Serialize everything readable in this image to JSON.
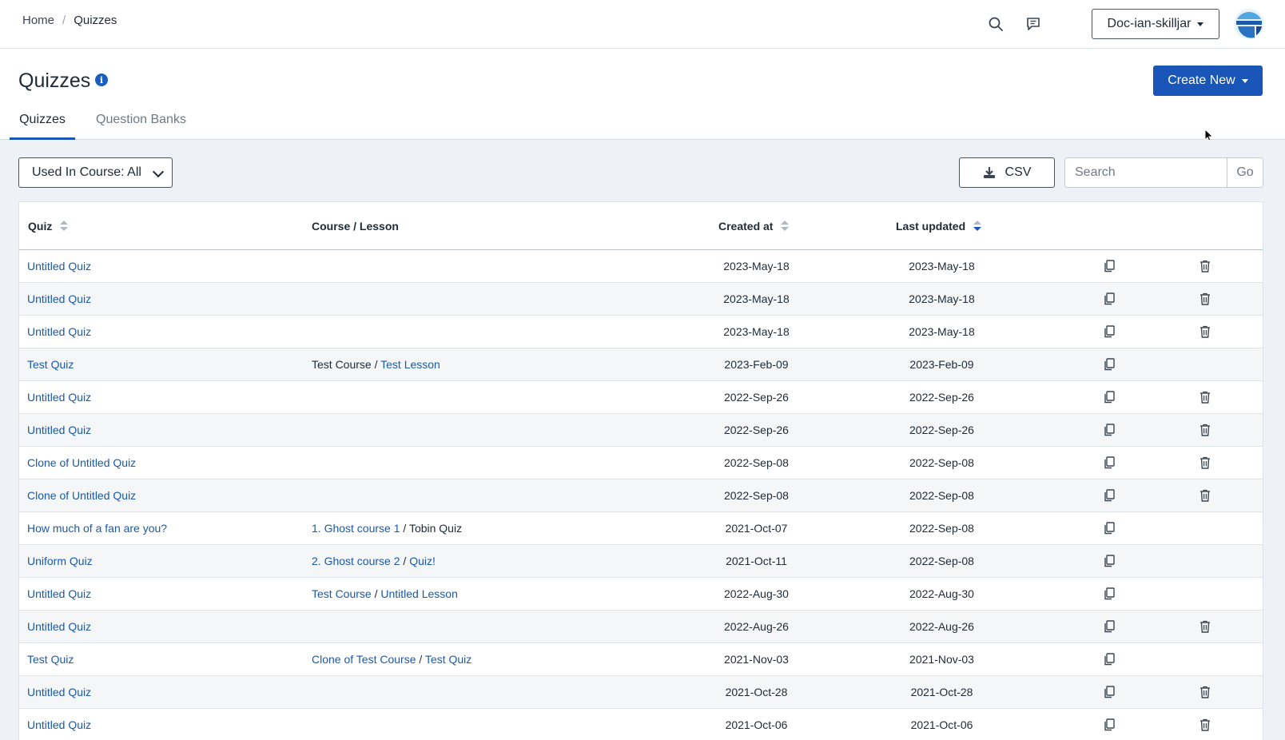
{
  "breadcrumb": {
    "home": "Home",
    "separator": "/",
    "current": "Quizzes"
  },
  "topbar": {
    "org_select": "Doc-ian-skilljar",
    "icons": [
      "search-icon",
      "chat-icon",
      "chevron-down-icon",
      "avatar"
    ]
  },
  "header": {
    "title": "Quizzes",
    "info_glyph": "i",
    "create_label": "Create New",
    "tabs": [
      {
        "label": "Quizzes",
        "active": true
      },
      {
        "label": "Question Banks",
        "active": false
      }
    ]
  },
  "toolbar": {
    "filter_label": "Used In Course: All",
    "csv_label": "CSV",
    "search_placeholder": "Search",
    "go_label": "Go"
  },
  "table": {
    "columns": {
      "quiz": "Quiz",
      "course": "Course / Lesson",
      "created": "Created at",
      "updated": "Last updated"
    },
    "sort": {
      "active_column": "Last updated",
      "direction": "desc"
    },
    "rows": [
      {
        "quiz": "Untitled Quiz",
        "course": "",
        "lesson": "",
        "created": "2023-May-18",
        "updated": "2023-May-18",
        "deletable": true
      },
      {
        "quiz": "Untitled Quiz",
        "course": "",
        "lesson": "",
        "created": "2023-May-18",
        "updated": "2023-May-18",
        "deletable": true
      },
      {
        "quiz": "Untitled Quiz",
        "course": "",
        "lesson": "",
        "created": "2023-May-18",
        "updated": "2023-May-18",
        "deletable": true
      },
      {
        "quiz": "Test Quiz",
        "course": "Test Course",
        "lesson": "Test Lesson",
        "course_linked": false,
        "lesson_linked": true,
        "created": "2023-Feb-09",
        "updated": "2023-Feb-09",
        "deletable": false
      },
      {
        "quiz": "Untitled Quiz",
        "course": "",
        "lesson": "",
        "created": "2022-Sep-26",
        "updated": "2022-Sep-26",
        "deletable": true
      },
      {
        "quiz": "Untitled Quiz",
        "course": "",
        "lesson": "",
        "created": "2022-Sep-26",
        "updated": "2022-Sep-26",
        "deletable": true
      },
      {
        "quiz": "Clone of Untitled Quiz",
        "course": "",
        "lesson": "",
        "created": "2022-Sep-08",
        "updated": "2022-Sep-08",
        "deletable": true
      },
      {
        "quiz": "Clone of Untitled Quiz",
        "course": "",
        "lesson": "",
        "created": "2022-Sep-08",
        "updated": "2022-Sep-08",
        "deletable": true
      },
      {
        "quiz": "How much of a fan are you?",
        "course": "1. Ghost course 1",
        "lesson": "Tobin Quiz",
        "course_linked": true,
        "lesson_linked": false,
        "created": "2021-Oct-07",
        "updated": "2022-Sep-08",
        "deletable": false
      },
      {
        "quiz": "Uniform Quiz",
        "course": "2. Ghost course 2",
        "lesson": "Quiz!",
        "course_linked": true,
        "lesson_linked": true,
        "created": "2021-Oct-11",
        "updated": "2022-Sep-08",
        "deletable": false
      },
      {
        "quiz": "Untitled Quiz",
        "course": "Test Course",
        "lesson": "Untitled Lesson",
        "course_linked": true,
        "lesson_linked": true,
        "created": "2022-Aug-30",
        "updated": "2022-Aug-30",
        "deletable": false
      },
      {
        "quiz": "Untitled Quiz",
        "course": "",
        "lesson": "",
        "created": "2022-Aug-26",
        "updated": "2022-Aug-26",
        "deletable": true
      },
      {
        "quiz": "Test Quiz",
        "course": "Clone of Test Course",
        "lesson": "Test Quiz",
        "course_linked": true,
        "lesson_linked": true,
        "created": "2021-Nov-03",
        "updated": "2021-Nov-03",
        "deletable": false
      },
      {
        "quiz": "Untitled Quiz",
        "course": "",
        "lesson": "",
        "created": "2021-Oct-28",
        "updated": "2021-Oct-28",
        "deletable": true
      },
      {
        "quiz": "Untitled Quiz",
        "course": "",
        "lesson": "",
        "created": "2021-Oct-06",
        "updated": "2021-Oct-06",
        "deletable": true
      }
    ]
  },
  "colors": {
    "accent": "#1a56b8",
    "link": "#1a5aa8",
    "text": "#1f2a37",
    "page_bg": "#eef1f5"
  }
}
